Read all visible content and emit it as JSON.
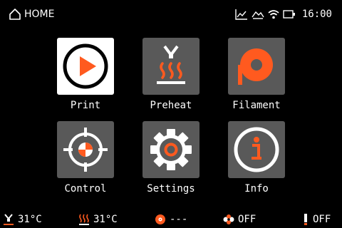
{
  "header": {
    "title": "HOME",
    "time": "16:00",
    "icons": [
      "home-icon",
      "chart-icon",
      "cloud-icon",
      "wifi-icon",
      "battery-icon"
    ]
  },
  "menu": {
    "items": [
      {
        "label": "Print",
        "icon": "play-icon",
        "active": true
      },
      {
        "label": "Preheat",
        "icon": "heater-icon",
        "active": false
      },
      {
        "label": "Filament",
        "icon": "filament-spool-icon",
        "active": false
      },
      {
        "label": "Control",
        "icon": "crosshair-icon",
        "active": false
      },
      {
        "label": "Settings",
        "icon": "gear-icon",
        "active": false
      },
      {
        "label": "Info",
        "icon": "info-icon",
        "active": false
      }
    ]
  },
  "status": {
    "nozzle_temp": "31°C",
    "bed_temp": "31°C",
    "filament": "---",
    "fan": "OFF",
    "light": "OFF"
  },
  "colors": {
    "accent": "#ff5a1f",
    "tile": "#595959",
    "tile_active": "#ffffff",
    "background": "#000000"
  }
}
